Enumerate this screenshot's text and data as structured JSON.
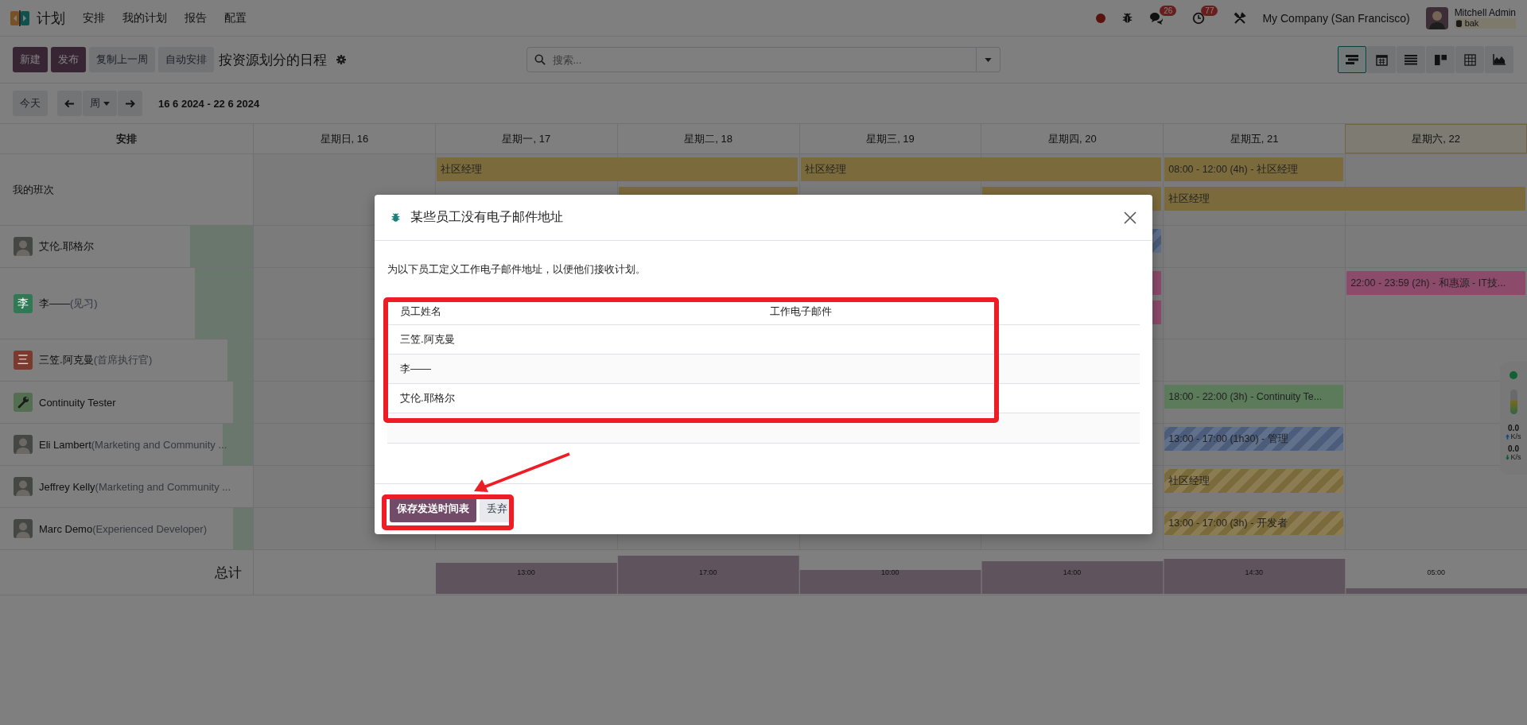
{
  "navbar": {
    "app_name": "计划",
    "menu": [
      "安排",
      "我的计划",
      "报告",
      "配置"
    ],
    "messages_badge": "26",
    "activities_badge": "77",
    "company": "My Company (San Francisco)",
    "user": "Mitchell Admin",
    "database": "bak"
  },
  "control_panel": {
    "buttons": [
      {
        "label": "新建",
        "kind": "primary"
      },
      {
        "label": "发布",
        "kind": "primary"
      },
      {
        "label": "复制上一周",
        "kind": "secondary"
      },
      {
        "label": "自动安排",
        "kind": "secondary"
      }
    ],
    "title": "按资源划分的日程",
    "search": {
      "placeholder": "搜索..."
    },
    "views": [
      {
        "kind": "gantt",
        "selected": true
      },
      {
        "kind": "calendar",
        "selected": false
      },
      {
        "kind": "list",
        "selected": false
      },
      {
        "kind": "kanban",
        "selected": false
      },
      {
        "kind": "pivot",
        "selected": false
      },
      {
        "kind": "graph",
        "selected": false
      }
    ]
  },
  "date_nav": {
    "today": "今天",
    "scale": "周",
    "range": "16 6 2024 - 22 6 2024"
  },
  "gantt": {
    "group_header": "安排",
    "days": [
      {
        "label": "星期日, 16",
        "today": false
      },
      {
        "label": "星期一, 17",
        "today": false
      },
      {
        "label": "星期二, 18",
        "today": false
      },
      {
        "label": "星期三, 19",
        "today": false
      },
      {
        "label": "星期四, 20",
        "today": false
      },
      {
        "label": "星期五, 21",
        "today": false
      },
      {
        "label": "星期六, 22",
        "today": true
      }
    ],
    "rows": [
      {
        "kind": "group",
        "name": "我的班次",
        "shifts": [
          {
            "text": "社区经理",
            "color": "#7b6a3b",
            "striped": false
          },
          {
            "text": "社区经理",
            "color": "#7b6a3b",
            "striped": false
          },
          {
            "text": "08:00 - 12:00 (4h) - 社区经理",
            "color": "#7b6a3b",
            "striped": false
          },
          {
            "color": "#7b6a3b",
            "striped": false
          },
          {
            "color": "#7b6a3b",
            "striped": false
          },
          {
            "text": "社区经理",
            "color": "#7b6a3b",
            "striped": false
          }
        ]
      },
      {
        "kind": "resource",
        "name": "艾伦.耶格尔",
        "avatar": {
          "kind": "photo"
        },
        "level": 0.25,
        "shifts": [
          {
            "color": "#4b5d7b",
            "striped": true
          }
        ]
      },
      {
        "kind": "resource",
        "name": "李——",
        "role": "(见习)",
        "avatar": {
          "kind": "letter",
          "letter": "李",
          "color": "#2f7a55"
        },
        "level": 0.23,
        "shifts": [
          {
            "color": "#8c4b6b",
            "striped": false
          },
          {
            "color": "#8c4b6b",
            "striped": false
          },
          {
            "text": "22:00 - 23:59 (2h) - 和惠源 - IT技...",
            "color": "#8c4b6b",
            "striped": false
          }
        ]
      },
      {
        "kind": "resource",
        "name": "三笠.阿克曼",
        "role": "(首席执行官)",
        "avatar": {
          "kind": "letter",
          "letter": "三",
          "color": "#7a3a2e"
        },
        "level": 0.1
      },
      {
        "kind": "resource",
        "name": "Continuity Tester",
        "avatar": {
          "kind": "icon"
        },
        "level": 0.08,
        "shifts": [
          {
            "text": "18:00 - 22:00 (3h) - Continuity Te...",
            "color": "#5b7b5b",
            "striped": false
          }
        ]
      },
      {
        "kind": "resource",
        "name": "Eli Lambert",
        "role": "(Marketing and Community ...",
        "avatar": {
          "kind": "photo"
        },
        "level": 0.12,
        "shifts": [
          {
            "text": "13:00 - 17:00 (1h30) - 管理",
            "color": "#4b5d7b",
            "striped": true
          }
        ]
      },
      {
        "kind": "resource",
        "name": "Jeffrey Kelly",
        "role": "(Marketing and Community ...",
        "avatar": {
          "kind": "photo"
        },
        "shifts": [
          {
            "text": "社区经理",
            "color": "#7b6a3b",
            "striped": true
          }
        ]
      },
      {
        "kind": "resource",
        "name": "Marc Demo",
        "role": "(Experienced Developer)",
        "avatar": {
          "kind": "photo"
        },
        "level": 0.08,
        "shifts": [
          {
            "text": "13:00 - 17:00 (3h) - 开发者",
            "color": "#7b6a3b",
            "striped": true
          }
        ]
      }
    ],
    "totals": {
      "label": "总计",
      "hours": [
        "13:00",
        "17:00",
        "10:00",
        "14:00",
        "14:30",
        "05:00"
      ]
    }
  },
  "speed_widget": {
    "level": 0.55,
    "upload": "0.0",
    "upload_unit": "K/s",
    "download": "0.0",
    "download_unit": "K/s"
  },
  "dialog": {
    "title": "某些员工没有电子邮件地址",
    "message": "为以下员工定义工作电子邮件地址，以便他们接收计划。",
    "columns": [
      "员工姓名",
      "工作电子邮件"
    ],
    "rows": [
      "三笠.阿克曼",
      "李——",
      "艾伦.耶格尔"
    ],
    "buttons": [
      {
        "label": "保存发送时间表",
        "kind": "primary"
      },
      {
        "label": "丢弃",
        "kind": "secondary"
      }
    ]
  }
}
